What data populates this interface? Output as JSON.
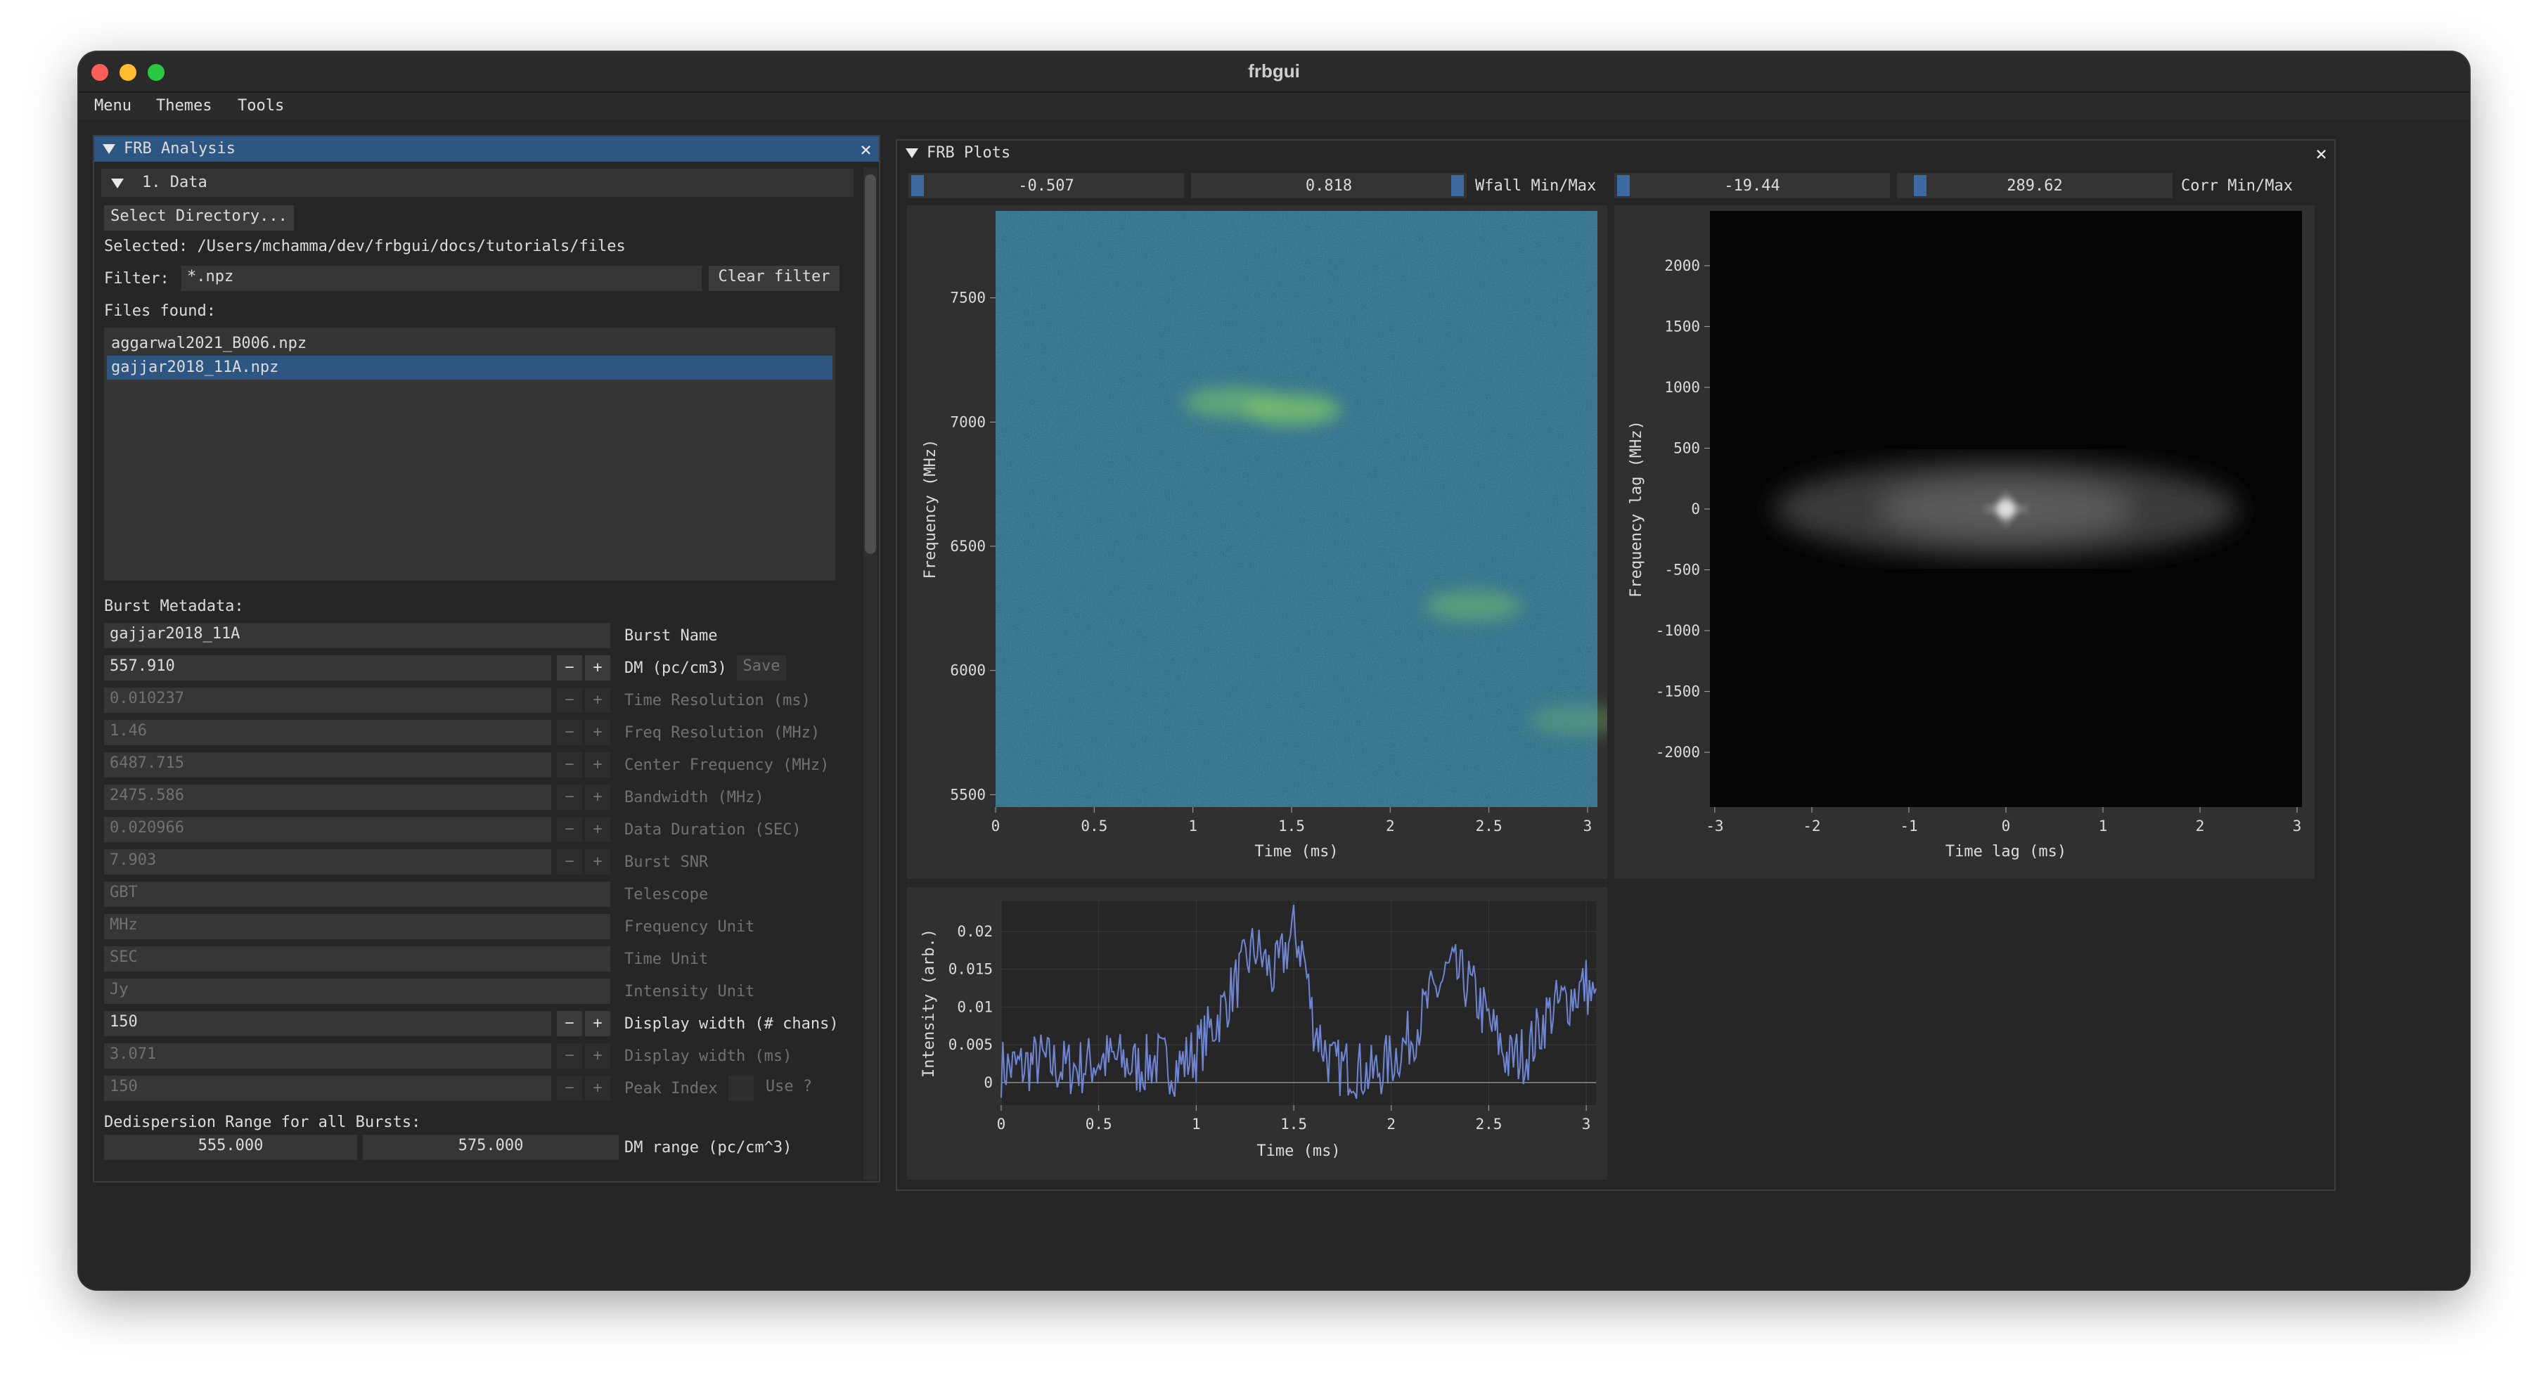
{
  "window": {
    "title": "frbgui"
  },
  "menubar": [
    "Menu",
    "Themes",
    "Tools"
  ],
  "analysis": {
    "title": "FRB Analysis",
    "section_data": "1. Data",
    "select_dir": "Select Directory...",
    "selected": "Selected: /Users/mchamma/dev/frbgui/docs/tutorials/files",
    "filter_label": "Filter:",
    "filter_value": "*.npz",
    "clear_filter": "Clear filter",
    "files_found": "Files found:",
    "files": [
      "aggarwal2021_B006.npz",
      "gajjar2018_11A.npz"
    ],
    "selected_file_index": 1,
    "burst_meta_label": "Burst Metadata:",
    "metadata": [
      {
        "value": "gajjar2018_11A",
        "label": "Burst Name",
        "stepper": false,
        "enabled": true
      },
      {
        "value": "557.910",
        "label": "DM (pc/cm3)",
        "stepper": true,
        "enabled": true,
        "extra": "Save"
      },
      {
        "value": "0.010237",
        "label": "Time Resolution (ms)",
        "stepper": true,
        "enabled": false
      },
      {
        "value": "1.46",
        "label": "Freq Resolution (MHz)",
        "stepper": true,
        "enabled": false
      },
      {
        "value": "6487.715",
        "label": "Center Frequency (MHz)",
        "stepper": true,
        "enabled": false
      },
      {
        "value": "2475.586",
        "label": "Bandwidth (MHz)",
        "stepper": true,
        "enabled": false
      },
      {
        "value": "0.020966",
        "label": "Data Duration (SEC)",
        "stepper": true,
        "enabled": false
      },
      {
        "value": "7.903",
        "label": "Burst SNR",
        "stepper": true,
        "enabled": false
      },
      {
        "value": "GBT",
        "label": "Telescope",
        "stepper": false,
        "enabled": false
      },
      {
        "value": "MHz",
        "label": "Frequency Unit",
        "stepper": false,
        "enabled": false
      },
      {
        "value": "SEC",
        "label": "Time Unit",
        "stepper": false,
        "enabled": false
      },
      {
        "value": "Jy",
        "label": "Intensity Unit",
        "stepper": false,
        "enabled": false
      },
      {
        "value": "150",
        "label": "Display width (# chans)",
        "stepper": true,
        "enabled": true
      },
      {
        "value": "3.071",
        "label": "Display width (ms)",
        "stepper": true,
        "enabled": false
      },
      {
        "value": "150",
        "label": "Peak Index",
        "stepper": true,
        "enabled": false,
        "extra": "Use ?"
      }
    ],
    "dedispersion_label": "Dedispersion Range for all Bursts:",
    "dm_range": {
      "min": "555.000",
      "max": "575.000",
      "label": "DM range (pc/cm^3)"
    }
  },
  "plots": {
    "title": "FRB Plots",
    "wfall_min": "-0.507",
    "wfall_max": "0.818",
    "wfall_label": "Wfall Min/Max",
    "corr_min": "-19.44",
    "corr_max": "289.62",
    "corr_label": "Corr Min/Max"
  },
  "chart_data": [
    {
      "type": "heatmap",
      "xlabel": "Time (ms)",
      "ylabel": "Frequency (MHz)",
      "xlim": [
        0,
        3.05
      ],
      "ylim": [
        5450,
        7850
      ],
      "xticks": [
        "0",
        "0.5",
        "1",
        "1.5",
        "2",
        "2.5",
        "3"
      ],
      "yticks": [
        "5500",
        "6000",
        "6500",
        "7000",
        "7500"
      ],
      "colormap": "viridis",
      "features": [
        {
          "t": 1.2,
          "f": 7080,
          "amp": 0.6
        },
        {
          "t": 1.5,
          "f": 7050,
          "amp": 0.8
        },
        {
          "t": 2.42,
          "f": 6260,
          "amp": 0.5
        },
        {
          "t": 2.95,
          "f": 5800,
          "amp": 0.35
        }
      ]
    },
    {
      "type": "heatmap",
      "xlabel": "Time lag (ms)",
      "ylabel": "Frequency lag (MHz)",
      "xlim": [
        -3.05,
        3.05
      ],
      "ylim": [
        -2450,
        2450
      ],
      "xticks": [
        "-3",
        "-2",
        "-1",
        "0",
        "1",
        "2",
        "3"
      ],
      "yticks": [
        "-2000",
        "-1500",
        "-1000",
        "-500",
        "0",
        "500",
        "1000",
        "1500",
        "2000"
      ],
      "colormap": "gray"
    },
    {
      "type": "line",
      "xlabel": "Time (ms)",
      "ylabel": "Intensity (arb.)",
      "xlim": [
        0,
        3.05
      ],
      "ylim": [
        -0.003,
        0.024
      ],
      "xticks": [
        "0",
        "0.5",
        "1",
        "1.5",
        "2",
        "2.5",
        "3"
      ],
      "yticks": [
        "0",
        "0.005",
        "0.01",
        "0.015",
        "0.02"
      ],
      "series": [
        {
          "color": "#6f86d6",
          "x": [
            0,
            0.1,
            0.2,
            0.3,
            0.4,
            0.5,
            0.6,
            0.7,
            0.8,
            0.9,
            1.0,
            1.1,
            1.2,
            1.3,
            1.4,
            1.5,
            1.55,
            1.6,
            1.7,
            1.8,
            1.9,
            2.0,
            2.1,
            2.2,
            2.3,
            2.4,
            2.5,
            2.6,
            2.7,
            2.8,
            2.9,
            3.0,
            3.05
          ],
          "y": [
            0.002,
            0.002,
            0.003,
            0.002,
            0.002,
            0.003,
            0.003,
            0.002,
            0.003,
            0.002,
            0.004,
            0.008,
            0.013,
            0.018,
            0.014,
            0.02,
            0.017,
            0.008,
            0.002,
            0.002,
            0.001,
            0.003,
            0.006,
            0.011,
            0.015,
            0.013,
            0.008,
            0.003,
            0.004,
            0.009,
            0.011,
            0.013,
            0.01
          ]
        }
      ]
    }
  ]
}
